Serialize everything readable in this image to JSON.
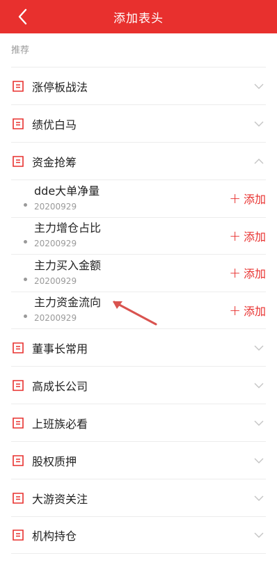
{
  "header": {
    "title": "添加表头",
    "back_icon": "chevron-left-icon"
  },
  "section": {
    "label": "推荐"
  },
  "colors": {
    "accent": "#e8302e",
    "muted": "#9a9a9a",
    "divider": "#ececec"
  },
  "categories_top": [
    {
      "label": "涨停板战法",
      "icon": "list-doc-icon",
      "expanded": false
    },
    {
      "label": "绩优白马",
      "icon": "list-doc-icon",
      "expanded": false
    },
    {
      "label": "资金抢筹",
      "icon": "list-doc-icon",
      "expanded": true
    }
  ],
  "sub_items": [
    {
      "name": "dde大单净量",
      "date": "20200929",
      "add_label": "添加"
    },
    {
      "name": "主力增仓占比",
      "date": "20200929",
      "add_label": "添加"
    },
    {
      "name": "主力买入金额",
      "date": "20200929",
      "add_label": "添加"
    },
    {
      "name": "主力资金流向",
      "date": "20200929",
      "add_label": "添加"
    }
  ],
  "categories_bottom": [
    {
      "label": "董事长常用",
      "icon": "list-doc-icon",
      "expanded": false
    },
    {
      "label": "高成长公司",
      "icon": "list-doc-icon",
      "expanded": false
    },
    {
      "label": "上班族必看",
      "icon": "list-doc-icon",
      "expanded": false
    },
    {
      "label": "股权质押",
      "icon": "list-doc-icon",
      "expanded": false
    },
    {
      "label": "大游资关注",
      "icon": "list-doc-icon",
      "expanded": false
    },
    {
      "label": "机构持仓",
      "icon": "list-doc-icon",
      "expanded": false
    }
  ]
}
